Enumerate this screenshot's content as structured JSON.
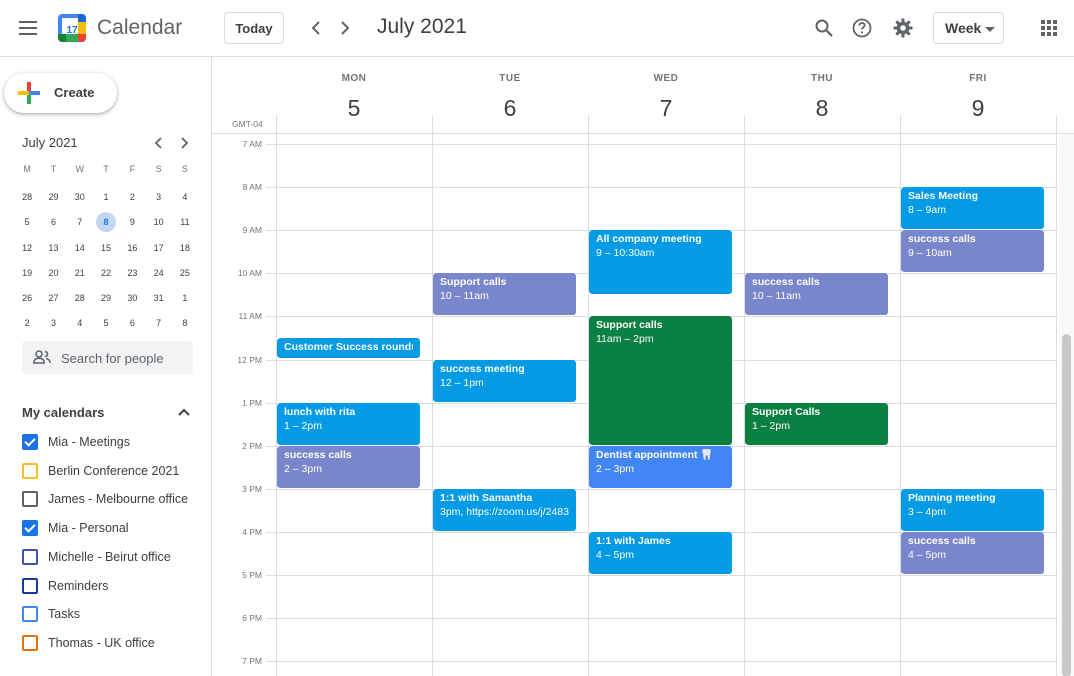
{
  "header": {
    "app_title": "Calendar",
    "logo_day": "17",
    "today_label": "Today",
    "period_title": "July 2021",
    "view_label": "Week"
  },
  "sidebar": {
    "create_label": "Create",
    "mini_calendar": {
      "title": "July 2021",
      "weekdays": [
        "M",
        "T",
        "W",
        "T",
        "F",
        "S",
        "S"
      ],
      "weeks": [
        [
          "28",
          "29",
          "30",
          "1",
          "2",
          "3",
          "4"
        ],
        [
          "5",
          "6",
          "7",
          "8",
          "9",
          "10",
          "11"
        ],
        [
          "12",
          "13",
          "14",
          "15",
          "16",
          "17",
          "18"
        ],
        [
          "19",
          "20",
          "21",
          "22",
          "23",
          "24",
          "25"
        ],
        [
          "26",
          "27",
          "28",
          "29",
          "30",
          "31",
          "1"
        ],
        [
          "2",
          "3",
          "4",
          "5",
          "6",
          "7",
          "8"
        ]
      ],
      "selected_day": "8"
    },
    "search_people_placeholder": "Search for people",
    "my_calendars_title": "My calendars",
    "calendars": [
      {
        "name": "Mia - Meetings",
        "color": "#1a73e8",
        "checked": true
      },
      {
        "name": "Berlin Conference 2021",
        "color": "#f6bf26",
        "checked": false
      },
      {
        "name": "James - Melbourne office",
        "color": "#616161",
        "checked": false
      },
      {
        "name": "Mia - Personal",
        "color": "#1a73e8",
        "checked": true
      },
      {
        "name": "Michelle - Beirut office",
        "color": "#3f51b5",
        "checked": false
      },
      {
        "name": "Reminders",
        "color": "#1a3a8f",
        "checked": false
      },
      {
        "name": "Tasks",
        "color": "#4285f4",
        "checked": false
      },
      {
        "name": "Thomas - UK office",
        "color": "#e8710a",
        "checked": false
      }
    ]
  },
  "week": {
    "timezone": "GMT-04",
    "days": [
      {
        "dow": "MON",
        "num": "5"
      },
      {
        "dow": "TUE",
        "num": "6"
      },
      {
        "dow": "WED",
        "num": "7"
      },
      {
        "dow": "THU",
        "num": "8"
      },
      {
        "dow": "FRI",
        "num": "9"
      }
    ],
    "hours": [
      "7 AM",
      "8 AM",
      "9 AM",
      "10 AM",
      "11 AM",
      "12 PM",
      "1 PM",
      "2 PM",
      "3 PM",
      "4 PM",
      "5 PM",
      "6 PM",
      "7 PM"
    ],
    "first_hour": 7
  },
  "colors": {
    "blue": "#039be5",
    "lavender": "#7986cb",
    "green": "#0b8043",
    "peacock": "#4285f4"
  },
  "events": [
    {
      "day": 0,
      "start": 11.5,
      "end": 12.0,
      "title": "Customer Success roundup,",
      "time": "",
      "color": "#039be5"
    },
    {
      "day": 0,
      "start": 13,
      "end": 14,
      "title": "lunch with rita",
      "time": "1 – 2pm",
      "color": "#039be5"
    },
    {
      "day": 0,
      "start": 14,
      "end": 15,
      "title": "success calls",
      "time": "2 – 3pm",
      "color": "#7986cb"
    },
    {
      "day": 1,
      "start": 10,
      "end": 11,
      "title": "Support calls",
      "time": "10 – 11am",
      "color": "#7986cb"
    },
    {
      "day": 1,
      "start": 12,
      "end": 13,
      "title": "success meeting",
      "time": "12 – 1pm",
      "color": "#039be5"
    },
    {
      "day": 1,
      "start": 15,
      "end": 16,
      "title": "1:1 with Samantha",
      "time": "3pm, https://zoom.us/j/2483",
      "color": "#039be5"
    },
    {
      "day": 2,
      "start": 9,
      "end": 10.5,
      "title": "All company meeting",
      "time": "9 – 10:30am",
      "color": "#039be5"
    },
    {
      "day": 2,
      "start": 11,
      "end": 14,
      "title": "Support calls",
      "time": "11am – 2pm",
      "color": "#0b8043"
    },
    {
      "day": 2,
      "start": 14,
      "end": 15,
      "title": "Dentist appointment 🦷",
      "time": "2 – 3pm",
      "color": "#4285f4"
    },
    {
      "day": 2,
      "start": 16,
      "end": 17,
      "title": "1:1 with James",
      "time": "4 – 5pm",
      "color": "#039be5"
    },
    {
      "day": 3,
      "start": 10,
      "end": 11,
      "title": "success calls",
      "time": "10 – 11am",
      "color": "#7986cb"
    },
    {
      "day": 3,
      "start": 13,
      "end": 14,
      "title": "Support Calls",
      "time": "1 – 2pm",
      "color": "#0b8043"
    },
    {
      "day": 4,
      "start": 8,
      "end": 9,
      "title": "Sales Meeting",
      "time": "8 – 9am",
      "color": "#039be5"
    },
    {
      "day": 4,
      "start": 9,
      "end": 10,
      "title": "success calls",
      "time": "9 – 10am",
      "color": "#7986cb"
    },
    {
      "day": 4,
      "start": 15,
      "end": 16,
      "title": "Planning meeting",
      "time": "3 – 4pm",
      "color": "#039be5"
    },
    {
      "day": 4,
      "start": 16,
      "end": 17,
      "title": "success calls",
      "time": "4 – 5pm",
      "color": "#7986cb"
    }
  ]
}
